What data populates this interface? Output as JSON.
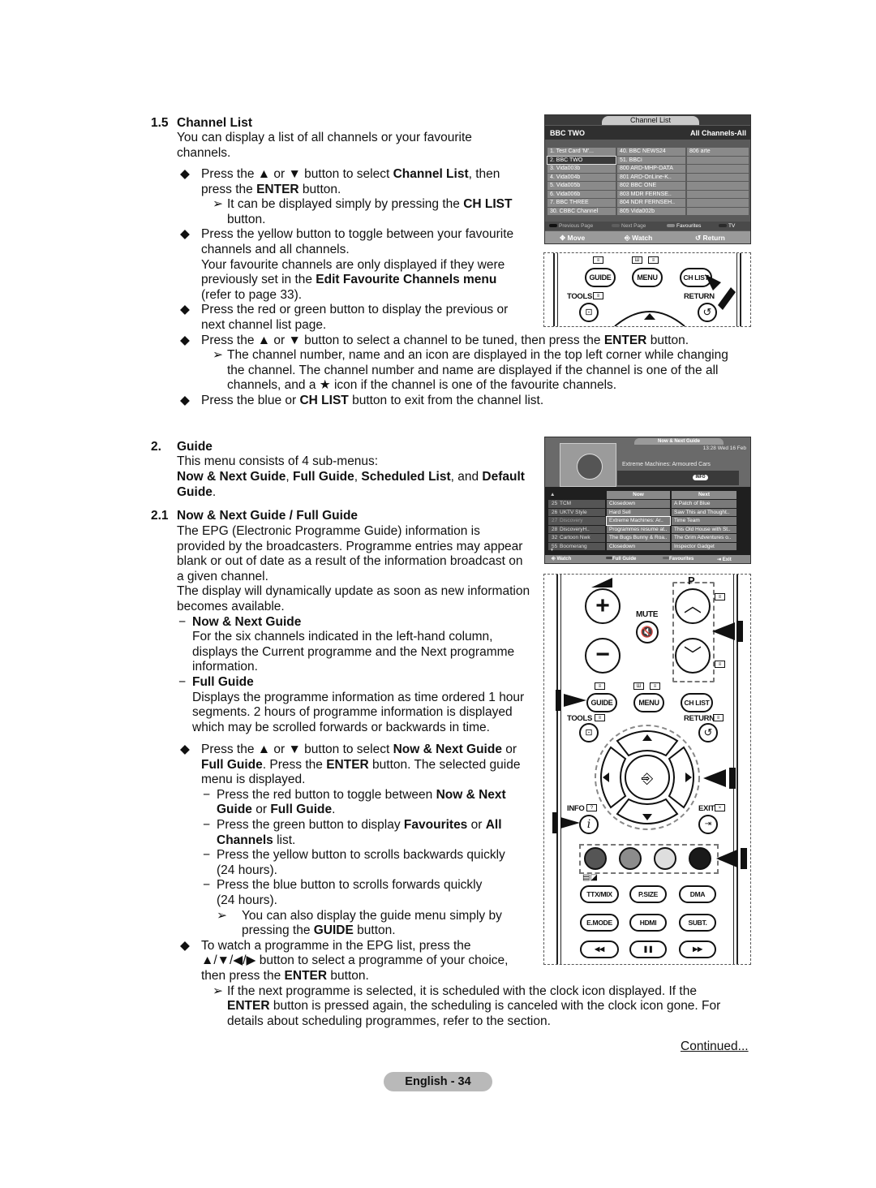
{
  "section_1_5": {
    "number": "1.5",
    "title": "Channel List",
    "intro": [
      "You can display a list of all channels or your favourite",
      "channels."
    ],
    "bullets": [
      {
        "lines": [
          [
            "Press the ▲ or ▼ button to select ",
            "Channel List",
            ", then"
          ],
          [
            "press the ",
            "ENTER",
            " button."
          ]
        ]
      },
      {
        "note": [
          [
            "It can be displayed simply by pressing the ",
            "CH LIST"
          ],
          [
            "button."
          ]
        ]
      },
      {
        "lines": [
          [
            "Press the yellow button to toggle between your favourite"
          ],
          [
            "channels and all channels."
          ],
          [
            "Your favourite channels are only displayed if they were"
          ],
          [
            "previously set in the ",
            "Edit Favourite Channels menu"
          ],
          [
            "(refer to page 33)."
          ]
        ]
      },
      {
        "lines": [
          [
            "Press the red or green button to display the previous or"
          ],
          [
            "next channel list page."
          ]
        ]
      },
      {
        "lines": [
          [
            "Press the ▲ or ▼ button to select a channel to be tuned, then press the ",
            "ENTER",
            " button."
          ]
        ]
      },
      {
        "note": [
          [
            "The channel number, name and an icon are displayed in the top left corner while changing"
          ],
          [
            "the channel. The channel number and name are displayed if the channel is one of the all"
          ],
          [
            "channels, and a ★ icon if the channel is one of the favourite channels."
          ]
        ]
      },
      {
        "lines": [
          [
            "Press the blue or ",
            "CH LIST",
            " button to exit from the channel list."
          ]
        ]
      }
    ]
  },
  "section_2": {
    "number": "2.",
    "title": "Guide",
    "intro": "This menu consists of 4 sub-menus:",
    "submenus": [
      "Now & Next Guide",
      "Full Guide",
      "Scheduled List",
      "Default Guide"
    ],
    "submenus_line": [
      [
        "Now & Next Guide",
        ", ",
        "Full Guide",
        ", ",
        "Scheduled List",
        ", and ",
        "Default"
      ],
      [
        "Guide",
        "."
      ]
    ]
  },
  "section_2_1": {
    "number": "2.1",
    "title": "Now & Next Guide / Full Guide",
    "para1": [
      "The EPG (Electronic Programme Guide) information is",
      "provided by the broadcasters. Programme entries may appear",
      "blank or out of date as a result of the information broadcast on",
      "a given channel."
    ],
    "para2": [
      "The display will dynamically update as soon as new information",
      "becomes available."
    ],
    "sub1_title": "Now & Next Guide",
    "sub1_text": [
      "For the six channels indicated in the left-hand column,",
      "displays the Current programme and the Next programme",
      "information."
    ],
    "sub2_title": "Full Guide",
    "sub2_text": [
      "Displays the programme information as time ordered 1 hour",
      "segments. 2 hours of programme information is displayed",
      "which may be scrolled forwards or backwards in time."
    ],
    "b1": [
      [
        "Press the ▲ or ▼ button to select ",
        "Now & Next Guide",
        " or"
      ],
      [
        "Full Guide",
        ". Press the ",
        "ENTER",
        " button. The selected guide"
      ],
      [
        "menu is displayed."
      ]
    ],
    "d1": [
      [
        "Press the red button to toggle between ",
        "Now & Next"
      ],
      [
        "Guide",
        " or ",
        "Full Guide",
        "."
      ]
    ],
    "d2": [
      [
        "Press the green button to display ",
        "Favourites",
        " or ",
        "All"
      ],
      [
        "Channels",
        " list."
      ]
    ],
    "d3": [
      [
        "Press the yellow button to scrolls backwards quickly"
      ],
      [
        "(24 hours)."
      ]
    ],
    "d4": [
      [
        "Press the blue button to scrolls forwards quickly"
      ],
      [
        "(24 hours)."
      ]
    ],
    "note1": [
      [
        "You can also display the guide menu simply by"
      ],
      [
        "pressing the ",
        "GUIDE",
        " button."
      ]
    ],
    "b2": [
      [
        "To watch a programme in the EPG list, press the"
      ],
      [
        "▲/▼/◀/▶ button to select a programme of your choice,"
      ],
      [
        "then press the ",
        "ENTER",
        " button."
      ]
    ],
    "note2": [
      [
        "If the next programme is selected, it is scheduled with the clock icon displayed. If the"
      ],
      [
        "ENTER",
        " button is pressed again, the scheduling is canceled with the clock icon gone. For"
      ],
      [
        "details about scheduling programmes, refer to the section."
      ]
    ]
  },
  "channel_list_osd": {
    "title": "Channel List",
    "current_channel": "BBC TWO",
    "mode": "All Channels-All",
    "columns": [
      [
        "1.  Test Card 'M'...",
        "2.  BBC TWO",
        "3.  Vida003b",
        "4.  Vida004b",
        "5.  Vida005b",
        "6.  Vida006b",
        "7.  BBC THREE",
        "30. CBBC Channel"
      ],
      [
        "40.  BBC NEWS24",
        "51.  BBCi",
        "800 ARD-MHP-DATA",
        "801 ARD-OnLine-K..",
        "802 BBC ONE",
        "803 MDR FERNSE..",
        "804 NDR FERNSEH..",
        "805 Vida002b"
      ],
      [
        "806 arte",
        "",
        "",
        "",
        "",
        "",
        "",
        ""
      ]
    ],
    "selected_index": 1,
    "legend": {
      "red": "Previous Page",
      "green": "Next Page",
      "yellow": "Favourites",
      "blue": "TV"
    },
    "nav": {
      "move": "Move",
      "watch": "Watch",
      "return": "Return"
    }
  },
  "remote_top": {
    "guide": "GUIDE",
    "menu": "MENU",
    "chlist": "CH LIST",
    "tools": "TOOLS",
    "return": "RETURN"
  },
  "guide_osd": {
    "title": "Now & Next Guide",
    "datetime": "13:28 Wed 16 Feb",
    "current_programme": "Extreme Machines: Armoured Cars",
    "info_button": "INFO",
    "col_now": "Now",
    "col_next": "Next",
    "rows": [
      {
        "num": "25",
        "channel": "TCM",
        "now": "Closedown",
        "next": "A Patch of Blue"
      },
      {
        "num": "26",
        "channel": "UKTV Style",
        "now": "Hard Sell",
        "next": "Saw This and Thought.."
      },
      {
        "num": "27",
        "channel": "Discovery",
        "now": "Extreme Machines: Ar..",
        "next": "Time Team"
      },
      {
        "num": "28",
        "channel": "DiscoveryH..",
        "now": "Programmes resume at..",
        "next": "This Old House with St.."
      },
      {
        "num": "32",
        "channel": "Cartoon Nwk",
        "now": "The Bugs Bunny & Roa..",
        "next": "The Grim Adventures o.."
      },
      {
        "num": "55",
        "channel": "Boomerang",
        "now": "Closedown",
        "next": "Inspector Gadget"
      }
    ],
    "selected_row": 2,
    "footer": {
      "watch": "Watch",
      "full_guide": "Full Guide",
      "favourites": "Favourites",
      "exit": "Exit"
    }
  },
  "remote_full": {
    "p": "P",
    "mute": "MUTE",
    "guide": "GUIDE",
    "menu": "MENU",
    "chlist": "CH LIST",
    "tools": "TOOLS",
    "return": "RETURN",
    "info": "INFO",
    "exit": "EXIT",
    "ttxmix": "TTX/MIX",
    "psize": "P.SIZE",
    "dma": "DMA",
    "emode": "E.MODE",
    "hdmi": "HDMI",
    "subt": "SUBT.",
    "color_buttons": [
      "#555555",
      "#8c8c8c",
      "#dedede",
      "#1a1a1a"
    ]
  },
  "footer": {
    "continued": "Continued...",
    "page_label": "English - 34"
  }
}
